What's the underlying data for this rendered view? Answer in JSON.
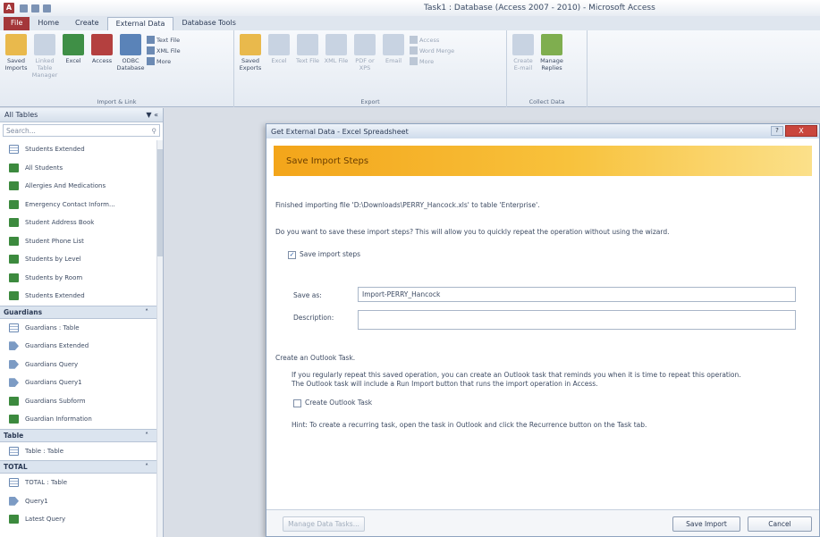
{
  "window": {
    "title": "Task1 : Database (Access 2007 - 2010) - Microsoft Access"
  },
  "ribbon_tabs": [
    {
      "label": "File"
    },
    {
      "label": "Home"
    },
    {
      "label": "Create"
    },
    {
      "label": "External Data"
    },
    {
      "label": "Database Tools"
    }
  ],
  "ribbon": {
    "import_group": {
      "label": "Import & Link",
      "buttons": [
        "Saved Imports",
        "Linked Table Manager",
        "Excel",
        "Access",
        "ODBC Database"
      ],
      "small": [
        "Text File",
        "XML File",
        "More"
      ]
    },
    "export_group": {
      "label": "Export",
      "buttons": [
        "Saved Exports",
        "Excel",
        "Text File",
        "XML File",
        "PDF or XPS",
        "Email"
      ],
      "small": [
        "Access",
        "Word Merge",
        "More"
      ]
    },
    "collect_group": {
      "label": "Collect Data",
      "buttons": [
        "Create E-mail",
        "Manage Replies"
      ]
    }
  },
  "nav": {
    "header": "All Tables",
    "search_placeholder": "Search...",
    "top_items": [
      {
        "label": "Students Extended",
        "type": "table"
      },
      {
        "label": "All Students",
        "type": "form"
      },
      {
        "label": "Allergies And Medications",
        "type": "form"
      },
      {
        "label": "Emergency Contact Inform...",
        "type": "form"
      },
      {
        "label": "Student Address Book",
        "type": "form"
      },
      {
        "label": "Student Phone List",
        "type": "form"
      },
      {
        "label": "Students by Level",
        "type": "form"
      },
      {
        "label": "Students by Room",
        "type": "form"
      },
      {
        "label": "Students Extended",
        "type": "form"
      }
    ],
    "guardians": {
      "header": "Guardians",
      "items": [
        {
          "label": "Guardians : Table",
          "type": "table"
        },
        {
          "label": "Guardians Extended",
          "type": "query"
        },
        {
          "label": "Guardians Query",
          "type": "query"
        },
        {
          "label": "Guardians Query1",
          "type": "query"
        },
        {
          "label": "Guardians Subform",
          "type": "form"
        },
        {
          "label": "Guardian Information",
          "type": "form"
        }
      ]
    },
    "group3": {
      "header": "Table",
      "items": [
        {
          "label": "Table : Table",
          "type": "table"
        }
      ]
    },
    "total": {
      "header": "TOTAL",
      "items": [
        {
          "label": "TOTAL : Table",
          "type": "table"
        },
        {
          "label": "Query1",
          "type": "query"
        },
        {
          "label": "Latest Query",
          "type": "form"
        }
      ]
    }
  },
  "dialog": {
    "title": "Get External Data - Excel Spreadsheet",
    "help": "?",
    "close": "X",
    "banner": "Save Import Steps",
    "finished_text": "Finished importing file 'D:\\Downloads\\PERRY_Hancock.xls' to table 'Enterprise'.",
    "question": "Do you want to save these import steps? This will allow you to quickly repeat the operation without using the wizard.",
    "save_checkbox_label": "Save import steps",
    "save_checked": true,
    "save_as_label": "Save as:",
    "save_as_value": "Import-PERRY_Hancock",
    "description_label": "Description:",
    "description_value": "",
    "outlook_section": "Create an Outlook Task.",
    "outlook_text_1": "If you regularly repeat this saved operation, you can create an Outlook task that reminds you when it is time to repeat this operation.",
    "outlook_text_2": "The Outlook task will include a Run Import button that runs the import operation in Access.",
    "outlook_checkbox_label": "Create Outlook Task",
    "outlook_checked": false,
    "hint": "Hint: To create a recurring task, open the task in Outlook and click the Recurrence button on the Task tab.",
    "manage_button": "Manage Data Tasks...",
    "save_import_button": "Save Import",
    "cancel_button": "Cancel"
  }
}
